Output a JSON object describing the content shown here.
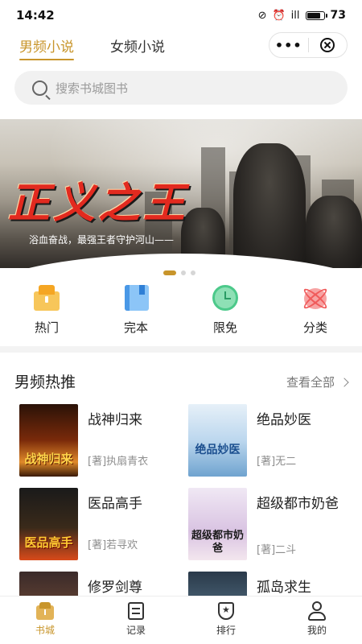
{
  "status_bar": {
    "time": "14:42",
    "signal": "ill",
    "battery": "73",
    "battery_level": 0.73
  },
  "header": {
    "tabs": [
      {
        "label": "男频小说",
        "active": true
      },
      {
        "label": "女频小说",
        "active": false
      }
    ],
    "menu_icon": "more-dots-icon",
    "close_icon": "close-circle-icon"
  },
  "search": {
    "placeholder": "搜索书城图书"
  },
  "banner": {
    "title": "正义之王",
    "subtitle": "浴血奋战，最强王者守护河山——",
    "page_count": 3,
    "active_index": 0
  },
  "categories": [
    {
      "label": "热门",
      "icon": "hot-box-icon",
      "color": "#f5b945"
    },
    {
      "label": "完本",
      "icon": "book-complete-icon",
      "color": "#5aa9f0"
    },
    {
      "label": "限免",
      "icon": "alarm-clock-icon",
      "color": "#4cc98a"
    },
    {
      "label": "分类",
      "icon": "category-atom-icon",
      "color": "#f27171"
    }
  ],
  "section": {
    "title": "男频热推",
    "more_label": "查看全部"
  },
  "books": [
    {
      "title": "战神归来",
      "author": "[著]执扇青衣",
      "cover_text": "战神归来"
    },
    {
      "title": "绝品妙医",
      "author": "[著]无二",
      "cover_text": "绝品妙医"
    },
    {
      "title": "医品高手",
      "author": "[著]若寻欢",
      "cover_text": "医品高手"
    },
    {
      "title": "超级都市奶爸",
      "author": "[著]二斗",
      "cover_text": "超级都市奶爸"
    },
    {
      "title": "修罗剑尊",
      "author": "",
      "cover_text": ""
    },
    {
      "title": "孤岛求生",
      "author": "",
      "cover_text": ""
    }
  ],
  "tabbar": [
    {
      "label": "书城",
      "icon": "bookstore-icon",
      "active": true
    },
    {
      "label": "记录",
      "icon": "history-list-icon",
      "active": false
    },
    {
      "label": "排行",
      "icon": "ranking-badge-icon",
      "active": false
    },
    {
      "label": "我的",
      "icon": "profile-icon",
      "active": false
    }
  ],
  "colors": {
    "accent": "#c8952b",
    "banner_title": "#e22a1f"
  }
}
